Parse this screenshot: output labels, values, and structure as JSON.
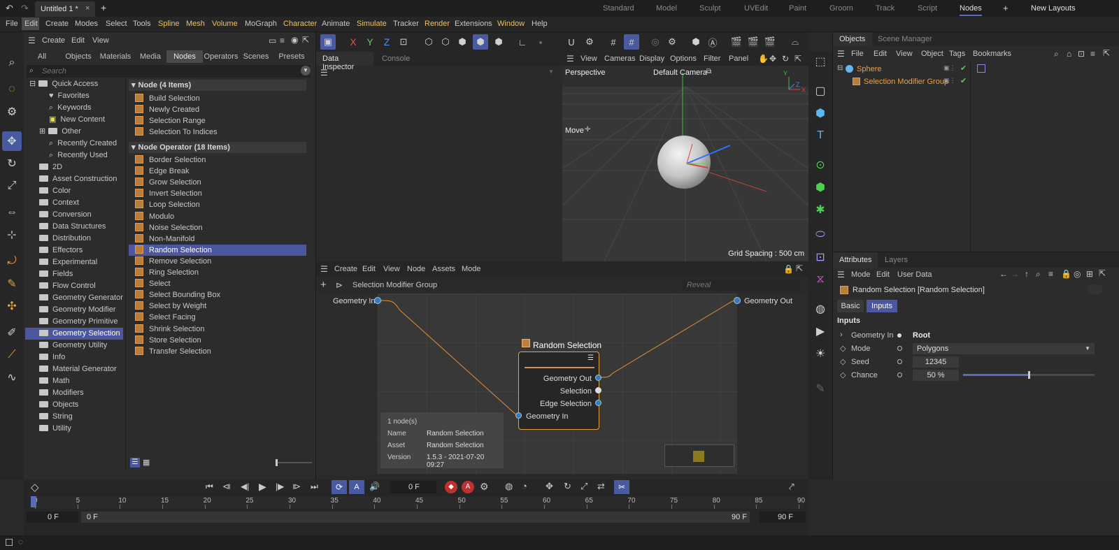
{
  "titlebar": {
    "tab_title": "Untitled 1 *",
    "add_tab": "+",
    "layouts": [
      "Standard",
      "Model",
      "Sculpt",
      "UVEdit",
      "Paint",
      "Groom",
      "Track",
      "Script",
      "Nodes"
    ],
    "active_layout": "Nodes",
    "plus": "+",
    "new_layouts": "New Layouts"
  },
  "menu": [
    "File",
    "Edit",
    "Create",
    "Modes",
    "Select",
    "Tools",
    "Spline",
    "Mesh",
    "Volume",
    "MoGraph",
    "Character",
    "Animate",
    "Simulate",
    "Tracker",
    "Render",
    "Extensions",
    "Window",
    "Help"
  ],
  "assets": {
    "menu": [
      "Create",
      "Edit",
      "View"
    ],
    "tabs": [
      "All",
      "Objects",
      "Materials",
      "Media",
      "Nodes",
      "Operators",
      "Scenes",
      "Presets"
    ],
    "active_tab": "Nodes",
    "search_placeholder": "Search",
    "tree": [
      "Quick Access",
      "Favorites",
      "Keywords",
      "New Content",
      "Other",
      "Recently Created",
      "Recently Used",
      "2D",
      "Asset Construction",
      "Color",
      "Context",
      "Conversion",
      "Data Structures",
      "Distribution",
      "Effectors",
      "Experimental",
      "Fields",
      "Flow Control",
      "Geometry Generator",
      "Geometry Modifier",
      "Geometry Primitive",
      "Geometry Selection",
      "Geometry Utility",
      "Info",
      "Material Generator",
      "Math",
      "Modifiers",
      "Objects",
      "String",
      "Utility"
    ],
    "selected_tree": "Geometry Selection",
    "section1": "Node (4 Items)",
    "nodes1": [
      "Build Selection",
      "Newly Created",
      "Selection Range",
      "Selection To Indices"
    ],
    "section2": "Node Operator (18 Items)",
    "nodes2": [
      "Border Selection",
      "Edge Break",
      "Grow Selection",
      "Invert Selection",
      "Loop Selection",
      "Modulo",
      "Noise Selection",
      "Non-Manifold",
      "Random Selection",
      "Remove Selection",
      "Ring Selection",
      "Select",
      "Select Bounding Box",
      "Select by Weight",
      "Select Facing",
      "Shrink Selection",
      "Store Selection",
      "Transfer Selection"
    ],
    "selected_node": "Random Selection"
  },
  "toolbar": {
    "x": "X",
    "y": "Y",
    "z": "Z"
  },
  "inspector": {
    "tabs": [
      "Data Inspector",
      "Console"
    ],
    "active": "Data Inspector"
  },
  "viewport": {
    "menu": [
      "View",
      "Cameras",
      "Display",
      "Options",
      "Filter",
      "Panel"
    ],
    "label": "Perspective",
    "camera": "Default Camera",
    "move": "Move",
    "grid_spacing": "Grid Spacing : 500 cm"
  },
  "node_editor": {
    "menu": [
      "Create",
      "Edit",
      "View",
      "Node",
      "Assets",
      "Mode"
    ],
    "breadcrumb": "Selection Modifier Group",
    "reveal_placeholder": "Reveal",
    "port_in": "Geometry In",
    "port_out": "Geometry Out",
    "node_title": "Random Selection",
    "node_ports": [
      "Geometry Out",
      "Selection",
      "Edge Selection"
    ],
    "node_input": "Geometry In",
    "info": {
      "count": "1 node(s)",
      "name_label": "Name",
      "name": "Random Selection",
      "asset_label": "Asset",
      "asset": "Random Selection",
      "version_label": "Version",
      "version": "1.5.3 - 2021-07-20 09:27"
    }
  },
  "objects": {
    "tabs": [
      "Objects",
      "Scene Manager"
    ],
    "menu": [
      "File",
      "Edit",
      "View",
      "Object",
      "Tags",
      "Bookmarks"
    ],
    "items": [
      "Sphere",
      "Selection Modifier Group"
    ]
  },
  "attributes": {
    "tabs": [
      "Attributes",
      "Layers"
    ],
    "menu": [
      "Mode",
      "Edit",
      "User Data"
    ],
    "title": "Random Selection [Random Selection]",
    "subtabs": [
      "Basic",
      "Inputs"
    ],
    "active_subtab": "Inputs",
    "section": "Inputs",
    "params": [
      {
        "label": "Geometry In",
        "value": "Root"
      },
      {
        "label": "Mode",
        "value": "Polygons"
      },
      {
        "label": "Seed",
        "value": "12345"
      },
      {
        "label": "Chance",
        "value": "50 %"
      }
    ],
    "chance_fraction": 0.5
  },
  "timeline": {
    "frame": "0 F",
    "ticks": [
      "0",
      "5",
      "10",
      "15",
      "20",
      "25",
      "30",
      "35",
      "40",
      "45",
      "50",
      "55",
      "60",
      "65",
      "70",
      "75",
      "80",
      "85",
      "90"
    ],
    "start": "0 F",
    "start2": "0 F",
    "end": "90 F",
    "end2": "90 F"
  },
  "colors": {
    "accent": "#4c57a0",
    "orange": "#e8a040",
    "menu_yellow": "#f0c060"
  }
}
